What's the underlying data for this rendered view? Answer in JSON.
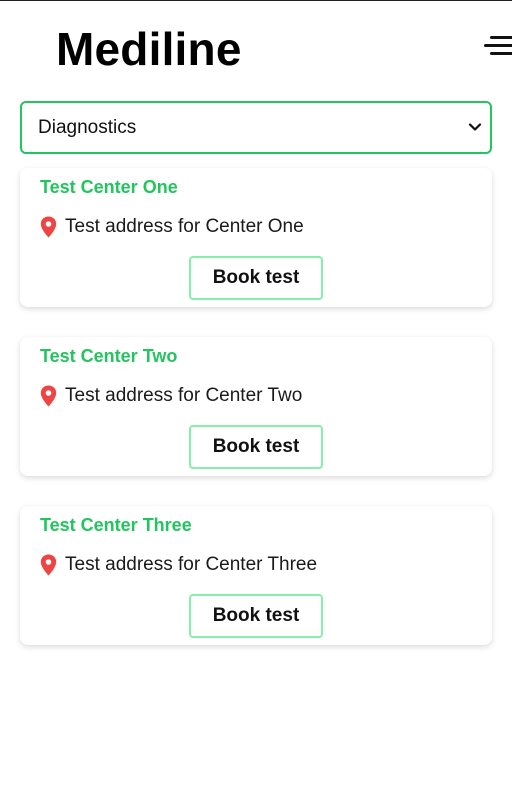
{
  "header": {
    "logo": "Mediline",
    "menu_icon": "hamburger-menu-icon"
  },
  "category_select": {
    "selected": "Diagnostics",
    "chevron_icon": "chevron-down-icon"
  },
  "colors": {
    "accent": "#22c55e",
    "button_border": "#86efac",
    "pin": "#ef4444"
  },
  "centers": [
    {
      "name": "Test Center One",
      "address": "Test address for Center One",
      "button_label": "Book test",
      "icon": "map-pin-icon"
    },
    {
      "name": "Test Center Two",
      "address": "Test address for Center Two",
      "button_label": "Book test",
      "icon": "map-pin-icon"
    },
    {
      "name": "Test Center Three",
      "address": "Test address for Center Three",
      "button_label": "Book test",
      "icon": "map-pin-icon"
    }
  ]
}
